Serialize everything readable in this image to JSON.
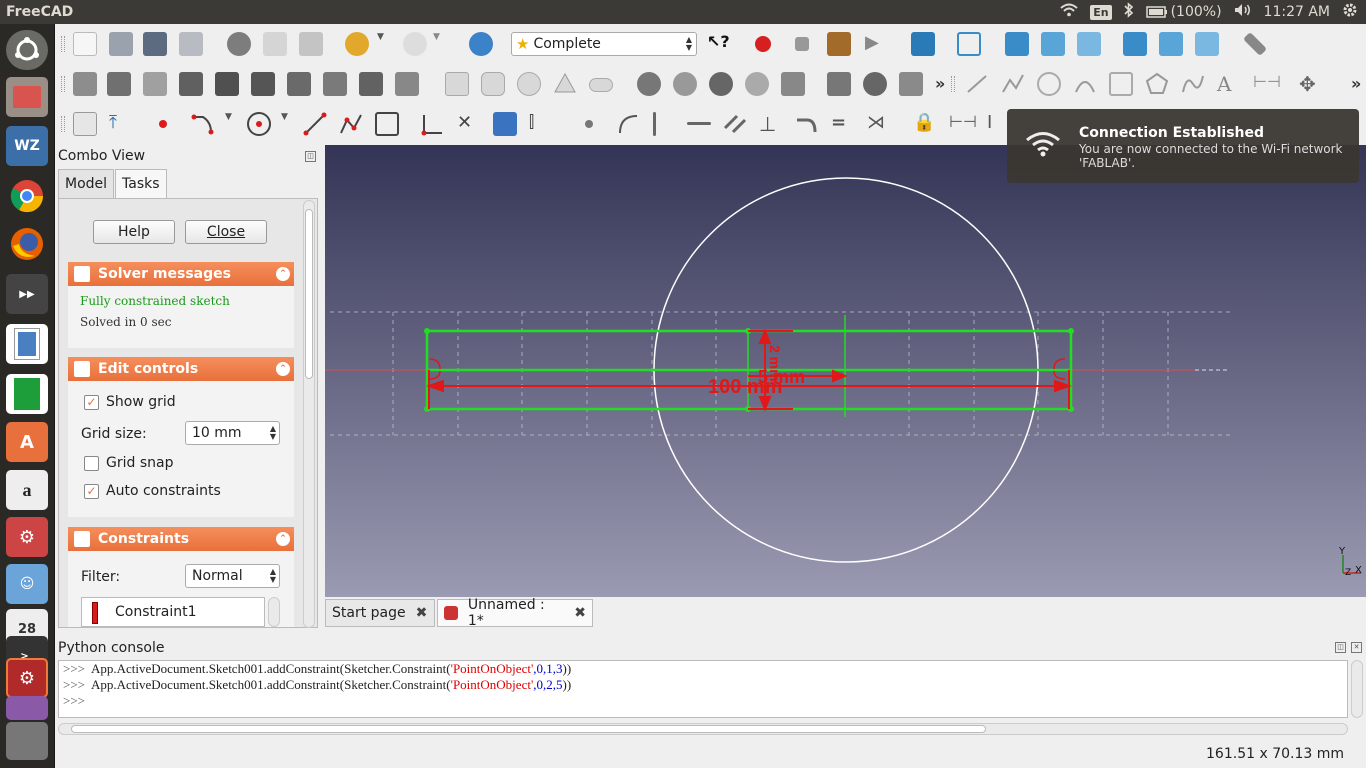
{
  "top_panel": {
    "app_title": "FreeCAD",
    "keyboard_layout": "En",
    "battery": "(100%)",
    "clock": "11:27 AM"
  },
  "toolbar": {
    "workbench_selector": "Complete"
  },
  "combo_view": {
    "title": "Combo View",
    "tabs": [
      {
        "label": "Model"
      },
      {
        "label": "Tasks"
      }
    ],
    "help_button": "Help",
    "close_button": "Close",
    "solver_messages": {
      "title": "Solver messages",
      "status": "Fully constrained sketch",
      "solved_time": "Solved in 0 sec"
    },
    "edit_controls": {
      "title": "Edit controls",
      "show_grid": {
        "label": "Show grid",
        "checked": true
      },
      "grid_size": {
        "label": "Grid size:",
        "value": "10 mm"
      },
      "grid_snap": {
        "label": "Grid snap",
        "checked": false
      },
      "auto_constraints": {
        "label": "Auto constraints",
        "checked": true
      }
    },
    "constraints": {
      "title": "Constraints",
      "filter_label": "Filter:",
      "filter_value": "Normal",
      "items": [
        {
          "label": "Constraint1"
        }
      ]
    }
  },
  "view3d": {
    "dim_length": "100 mm",
    "dim_height": "5 mm",
    "dim_vertical": "2 mm",
    "axis_y": "Y",
    "axis_x": "X",
    "axis_z": "Z"
  },
  "doc_tabs": [
    {
      "label": "Start page"
    },
    {
      "label": "Unnamed : 1*"
    }
  ],
  "python_console": {
    "title": "Python console",
    "lines": [
      {
        "prompt": ">>>",
        "code_prefix": "App.ActiveDocument.Sketch001.addConstraint(Sketcher.Constraint(",
        "string_arg": "'PointOnObject'",
        "args": ",0,1,3",
        "suffix": "))"
      },
      {
        "prompt": ">>>",
        "code_prefix": "App.ActiveDocument.Sketch001.addConstraint(Sketcher.Constraint(",
        "string_arg": "'PointOnObject'",
        "args": ",0,2,5",
        "suffix": "))"
      },
      {
        "prompt": ">>>",
        "code_prefix": "",
        "string_arg": "",
        "args": "",
        "suffix": ""
      }
    ]
  },
  "status_bar": {
    "coordinates": "161.51 x 70.13 mm"
  },
  "notification": {
    "title": "Connection Established",
    "body": "You are now connected to the Wi-Fi network 'FABLAB'."
  }
}
